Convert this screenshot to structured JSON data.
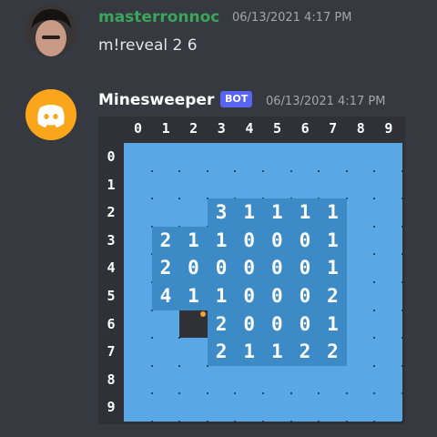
{
  "messages": [
    {
      "username": "masterronnoc",
      "timestamp": "06/13/2021 4:17 PM",
      "text": "m!reveal 2 6"
    },
    {
      "username": "Minesweeper",
      "tag": "BOT",
      "timestamp": "06/13/2021 4:17 PM"
    }
  ],
  "board": {
    "col_labels": [
      "0",
      "1",
      "2",
      "3",
      "4",
      "5",
      "6",
      "7",
      "8",
      "9"
    ],
    "row_labels": [
      "0",
      "1",
      "2",
      "3",
      "4",
      "5",
      "6",
      "7",
      "8",
      "9"
    ],
    "rows": [
      "##########",
      "##########",
      "###31111##",
      "#2110001##",
      "#2000001##",
      "#4110002##",
      "##X20001##",
      "###21122##",
      "##########",
      "##########"
    ],
    "colors": {
      "hidden": "#5aa7e6",
      "revealed": "#3d8bc6",
      "mine": "#2f3136"
    }
  }
}
